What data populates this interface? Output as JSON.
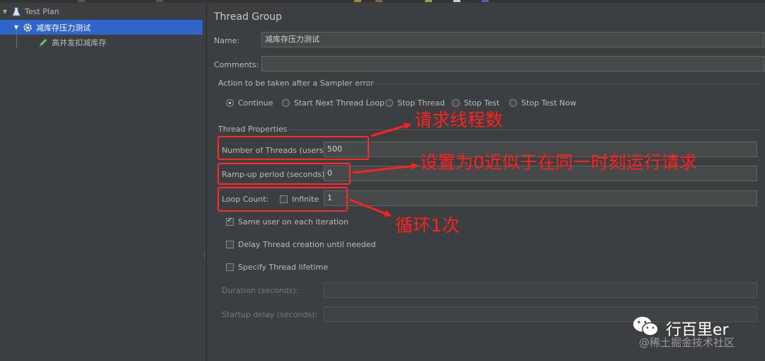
{
  "tree": {
    "items": [
      {
        "label": "Test Plan",
        "icon": "test-plan-icon"
      },
      {
        "label": "减库存压力测试",
        "icon": "gear-icon"
      },
      {
        "label": "高并发扣减库存",
        "icon": "pencil-icon"
      }
    ]
  },
  "panel": {
    "title": "Thread Group",
    "name_label": "Name:",
    "name_value": "减库存压力测试",
    "comments_label": "Comments:",
    "comments_value": "",
    "error_section": "Action to be taken after a Sampler error",
    "error_actions": [
      {
        "label": "Continue",
        "selected": true
      },
      {
        "label": "Start Next Thread Loop",
        "selected": false
      },
      {
        "label": "Stop Thread",
        "selected": false
      },
      {
        "label": "Stop Test",
        "selected": false
      },
      {
        "label": "Stop Test Now",
        "selected": false
      }
    ],
    "thread_section": "Thread Properties",
    "threads_label": "Number of Threads (users):",
    "threads_value": "500",
    "rampup_label": "Ramp-up period (seconds):",
    "rampup_value": "0",
    "loop_label": "Loop Count:",
    "infinite_label": "Infinite",
    "infinite_checked": false,
    "loop_value": "1",
    "same_user_label": "Same user on each iteration",
    "same_user_checked": true,
    "delay_label": "Delay Thread creation until needed",
    "delay_checked": false,
    "lifetime_label": "Specify Thread lifetime",
    "lifetime_checked": false,
    "duration_label": "Duration (seconds):",
    "duration_value": "",
    "startup_label": "Startup delay (seconds):",
    "startup_value": ""
  },
  "annotations": {
    "threads_note": "请求线程数",
    "rampup_note": "设置为0近似于在同一时刻运行请求",
    "loop_note": "循环1次",
    "color": "#ff2020"
  },
  "watermark": {
    "account": "行百里er",
    "community": "@稀土掘金技术社区"
  }
}
